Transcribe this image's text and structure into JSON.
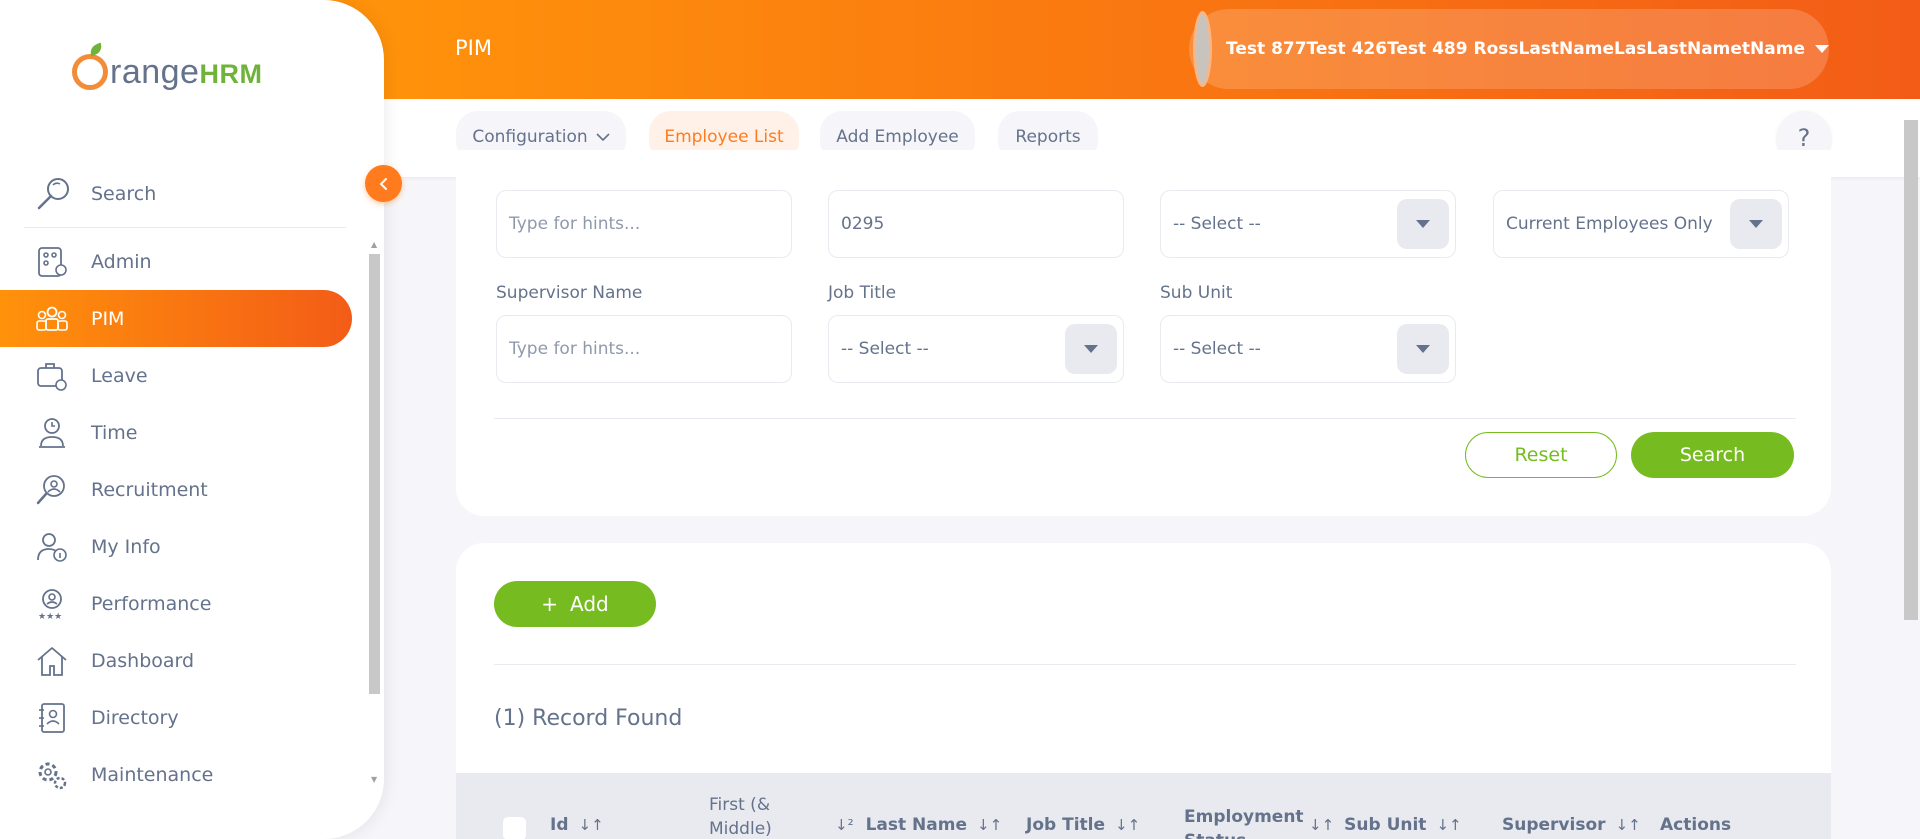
{
  "brand": {
    "logo_main": "range",
    "logo_hrm": "HRM"
  },
  "header": {
    "title": "PIM",
    "user_name": "Test 877Test 426Test 489 RossLastNameLasLastNametName"
  },
  "sidebar": {
    "search_label": "Search",
    "items": [
      {
        "label": "Admin",
        "icon": "admin-icon"
      },
      {
        "label": "PIM",
        "icon": "pim-icon",
        "active": true
      },
      {
        "label": "Leave",
        "icon": "leave-icon"
      },
      {
        "label": "Time",
        "icon": "time-icon"
      },
      {
        "label": "Recruitment",
        "icon": "recruitment-icon"
      },
      {
        "label": "My Info",
        "icon": "my-info-icon"
      },
      {
        "label": "Performance",
        "icon": "performance-icon"
      },
      {
        "label": "Dashboard",
        "icon": "dashboard-icon"
      },
      {
        "label": "Directory",
        "icon": "directory-icon"
      },
      {
        "label": "Maintenance",
        "icon": "maintenance-icon"
      }
    ]
  },
  "subnav": {
    "configuration": "Configuration",
    "employee_list": "Employee List",
    "add_employee": "Add Employee",
    "reports": "Reports",
    "help": "?"
  },
  "filters": {
    "employee_name_placeholder": "Type for hints...",
    "employee_id_value": "0295",
    "employment_status_value": "-- Select --",
    "include_value": "Current Employees Only",
    "supervisor_label": "Supervisor Name",
    "supervisor_placeholder": "Type for hints...",
    "job_title_label": "Job Title",
    "job_title_value": "-- Select --",
    "sub_unit_label": "Sub Unit",
    "sub_unit_value": "-- Select --",
    "reset_label": "Reset",
    "search_label": "Search"
  },
  "results": {
    "add_label": "Add",
    "add_plus": "+",
    "record_count": "(1) Record Found",
    "columns": {
      "id": "Id",
      "first_middle": "First (& Middle)",
      "first_sort": "↓²",
      "last_name": "Last Name",
      "job_title": "Job Title",
      "employment_status": "Employment Status",
      "sub_unit": "Sub Unit",
      "supervisor": "Supervisor",
      "actions": "Actions",
      "sort_glyph": "↓↑"
    }
  },
  "colors": {
    "brand_orange": "#ff7b1d",
    "brand_green": "#76bc21",
    "text": "#64728c"
  }
}
